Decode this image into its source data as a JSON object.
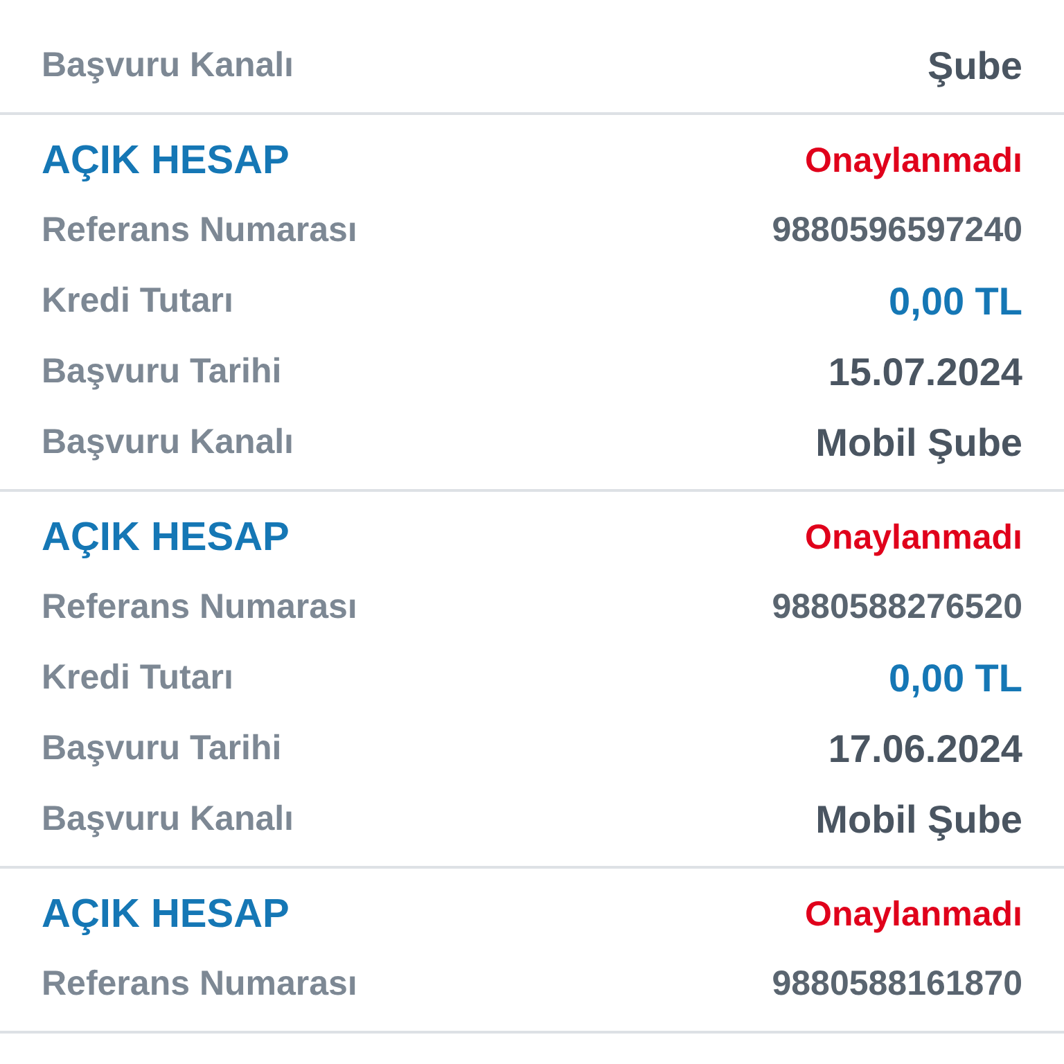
{
  "applications": [
    {
      "rows": [
        {
          "label": "Başvuru Kanalı",
          "value": "Şube",
          "kind": "text"
        }
      ]
    },
    {
      "title": "AÇIK HESAP",
      "status": "Onaylanmadı",
      "approved": false,
      "rows": [
        {
          "label": "Referans Numarası",
          "value": "9880596597240",
          "kind": "reference"
        },
        {
          "label": "Kredi Tutarı",
          "value": "0,00 TL",
          "kind": "amount"
        },
        {
          "label": "Başvuru Tarihi",
          "value": "15.07.2024",
          "kind": "text"
        },
        {
          "label": "Başvuru Kanalı",
          "value": "Mobil Şube",
          "kind": "text"
        }
      ]
    },
    {
      "title": "AÇIK HESAP",
      "status": "Onaylanmadı",
      "approved": false,
      "rows": [
        {
          "label": "Referans Numarası",
          "value": "9880588276520",
          "kind": "reference"
        },
        {
          "label": "Kredi Tutarı",
          "value": "0,00 TL",
          "kind": "amount"
        },
        {
          "label": "Başvuru Tarihi",
          "value": "17.06.2024",
          "kind": "text"
        },
        {
          "label": "Başvuru Kanalı",
          "value": "Mobil Şube",
          "kind": "text"
        }
      ]
    },
    {
      "title": "AÇIK HESAP",
      "status": "Onaylanmadı",
      "approved": false,
      "rows": [
        {
          "label": "Referans Numarası",
          "value": "9880588161870",
          "kind": "reference"
        }
      ]
    }
  ]
}
